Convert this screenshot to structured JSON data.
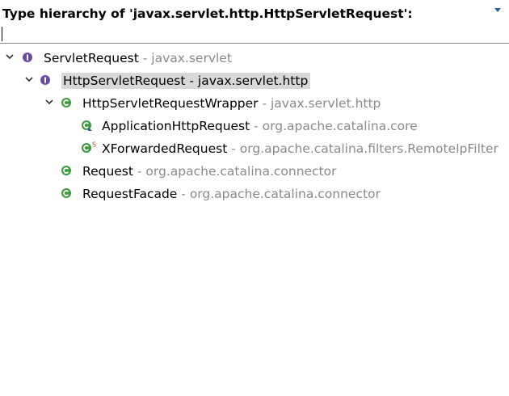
{
  "header": {
    "title": "Type hierarchy of 'javax.servlet.http.HttpServletRequest':",
    "filter_value": "",
    "menu_icon": "view-menu-arrow-icon"
  },
  "colors": {
    "interface_icon": "#6b4aa8",
    "class_icon": "#3f9a3f",
    "selection": "#d8d8d8",
    "package_text": "#8a8a8a"
  },
  "tree": {
    "rows": [
      {
        "name": "ServletRequest",
        "sep": " - ",
        "pkg": "javax.servlet",
        "icon": "interface-icon",
        "expanded": true
      },
      {
        "name": "HttpServletRequest",
        "sep": " - ",
        "pkg": "javax.servlet.http",
        "icon": "interface-icon",
        "expanded": true,
        "selected": true
      },
      {
        "name": "HttpServletRequestWrapper",
        "sep": " - ",
        "pkg": "javax.servlet.http",
        "icon": "class-icon",
        "expanded": true
      },
      {
        "name": "ApplicationHttpRequest",
        "sep": " - ",
        "pkg": "org.apache.catalina.core",
        "icon": "class-icon"
      },
      {
        "name": "XForwardedRequest",
        "sep": " - ",
        "pkg": "org.apache.catalina.filters.RemoteIpFilter",
        "icon": "static-class-icon"
      },
      {
        "name": "Request",
        "sep": " - ",
        "pkg": "org.apache.catalina.connector",
        "icon": "class-icon"
      },
      {
        "name": "RequestFacade",
        "sep": " - ",
        "pkg": "org.apache.catalina.connector",
        "icon": "class-icon"
      }
    ]
  }
}
